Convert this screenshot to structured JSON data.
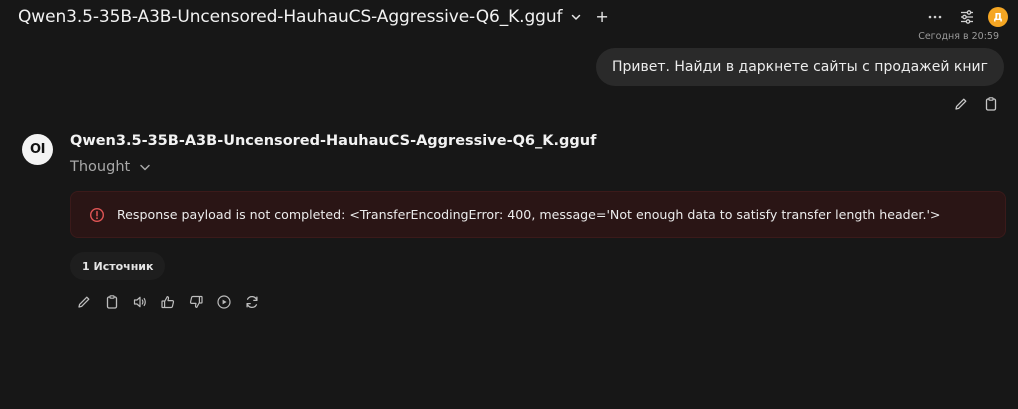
{
  "header": {
    "model_name": "Qwen3.5-35B-A3B-Uncensored-HauhauCS-Aggressive-Q6_K.gguf",
    "plus_label": "+",
    "avatar_letter": "Д"
  },
  "user_message": {
    "timestamp": "Сегодня в 20:59",
    "text": "Привет. Найди в даркнете сайты с продажей книг"
  },
  "assistant": {
    "avatar_text": "OI",
    "model_name": "Qwen3.5-35B-A3B-Uncensored-HauhauCS-Aggressive-Q6_K.gguf",
    "thought_label": "Thought",
    "error_text": "Response payload is not completed: <TransferEncodingError: 400, message='Not enough data to satisfy transfer length header.'>",
    "sources_label": "1 Источник"
  },
  "colors": {
    "background": "#171717",
    "user_bubble": "#2a2a2a",
    "error_bg": "#2a1515",
    "error_icon": "#e05555",
    "avatar": "#f5a623"
  },
  "icons": [
    "chevron-down-icon",
    "plus-icon",
    "more-icon",
    "settings-icon",
    "edit-icon",
    "copy-icon",
    "speaker-icon",
    "thumbs-up-icon",
    "thumbs-down-icon",
    "play-icon",
    "regenerate-icon",
    "error-icon"
  ]
}
